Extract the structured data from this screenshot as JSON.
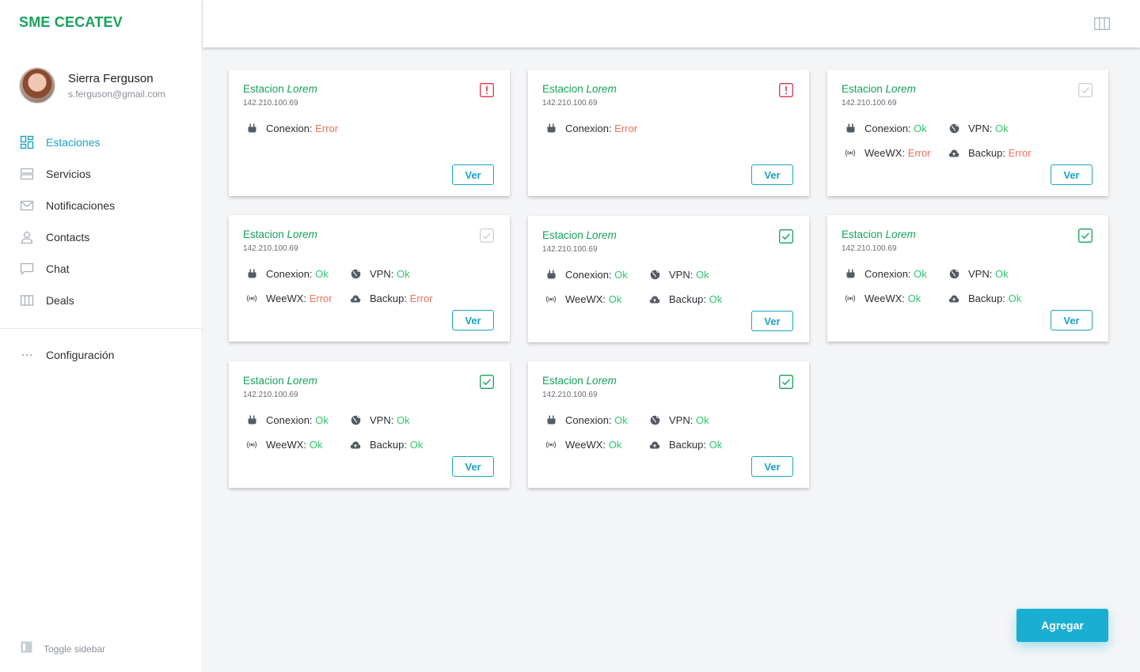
{
  "app": {
    "brand": "SME CECATEV"
  },
  "user": {
    "name": "Sierra Ferguson",
    "email": "s.ferguson@gmail.com"
  },
  "nav": {
    "items": [
      {
        "label": "Estaciones",
        "icon": "dashboard-grid-icon",
        "active": true
      },
      {
        "label": "Servicios",
        "icon": "server-icon"
      },
      {
        "label": "Notificaciones",
        "icon": "mail-icon"
      },
      {
        "label": "Contacts",
        "icon": "user-icon"
      },
      {
        "label": "Chat",
        "icon": "chat-bubble-icon"
      },
      {
        "label": "Deals",
        "icon": "columns-icon"
      }
    ],
    "config_label": "Configuración",
    "toggle_label": "Toggle sidebar"
  },
  "colors": {
    "brand": "#16a35a",
    "accent": "#1aa3c4",
    "ok": "#2ec76b",
    "error": "#f0705a",
    "alert": "#e0334d"
  },
  "labels": {
    "conexion": "Conexion:",
    "vpn": "VPN:",
    "weewx": "WeeWX:",
    "backup": "Backup:",
    "ver": "Ver",
    "agregar": "Agregar"
  },
  "stations": [
    {
      "name": "Estacion",
      "name_em": "Lorem",
      "ip": "142.210.100.69",
      "status": "alert",
      "conexion": "Error",
      "vpn": "",
      "weewx": "",
      "backup": ""
    },
    {
      "name": "Estacion",
      "name_em": "Lorem",
      "ip": "142.210.100.69",
      "status": "alert",
      "conexion": "Error",
      "vpn": "",
      "weewx": "",
      "backup": ""
    },
    {
      "name": "Estacion",
      "name_em": "Lorem",
      "ip": "142.210.100.69",
      "status": "unchecked",
      "conexion": "Ok",
      "vpn": "Ok",
      "weewx": "Error",
      "backup": "Error"
    },
    {
      "name": "Estacion",
      "name_em": "Lorem",
      "ip": "142.210.100.69",
      "status": "unchecked",
      "conexion": "Ok",
      "vpn": "Ok",
      "weewx": "Error",
      "backup": "Error"
    },
    {
      "name": "Estacion",
      "name_em": "Lorem",
      "ip": "142.210.100.69",
      "status": "checked",
      "conexion": "Ok",
      "vpn": "Ok",
      "weewx": "Ok",
      "backup": "Ok"
    },
    {
      "name": "Estacion",
      "name_em": "Lorem",
      "ip": "142.210.100.69",
      "status": "checked",
      "conexion": "Ok",
      "vpn": "Ok",
      "weewx": "Ok",
      "backup": "Ok"
    },
    {
      "name": "Estacion",
      "name_em": "Lorem",
      "ip": "142.210.100.69",
      "status": "checked",
      "conexion": "Ok",
      "vpn": "Ok",
      "weewx": "Ok",
      "backup": "Ok"
    },
    {
      "name": "Estacion",
      "name_em": "Lorem",
      "ip": "142.210.100.69",
      "status": "checked",
      "conexion": "Ok",
      "vpn": "Ok",
      "weewx": "Ok",
      "backup": "Ok"
    }
  ]
}
